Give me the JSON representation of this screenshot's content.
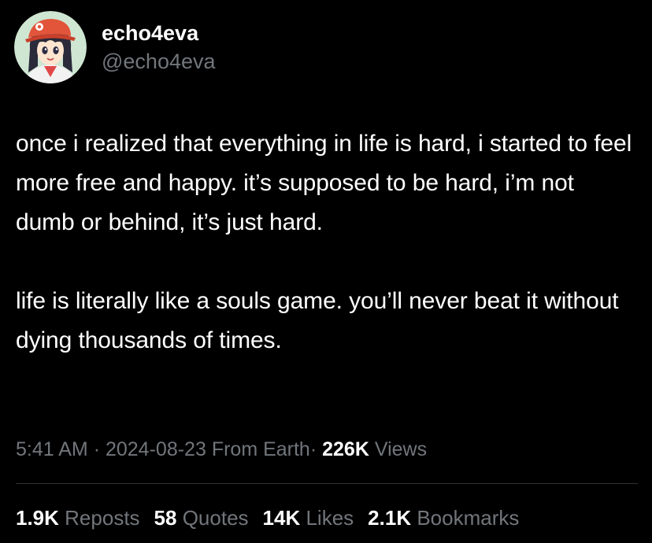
{
  "author": {
    "display_name": "echo4eva",
    "handle": "@echo4eva",
    "avatar_icon": "anime-girl-avatar"
  },
  "tweet": {
    "paragraphs": [
      "once i realized that everything in life is hard, i started to feel more free and happy. it’s supposed to be hard, i’m not dumb or behind, it’s just hard.",
      "life is literally like a souls game. you’ll never beat it without dying thousands of times."
    ]
  },
  "meta": {
    "time": "5:41 AM",
    "separator": "·",
    "date": "2024-08-23",
    "source": "From Earth",
    "views_count": "226K",
    "views_label": "Views"
  },
  "stats": {
    "reposts_count": "1.9K",
    "reposts_label": "Reposts",
    "quotes_count": "58",
    "quotes_label": "Quotes",
    "likes_count": "14K",
    "likes_label": "Likes",
    "bookmarks_count": "2.1K",
    "bookmarks_label": "Bookmarks"
  },
  "colors": {
    "background": "#000000",
    "primary_text": "#ffffff",
    "secondary_text": "#71767b",
    "divider": "#2f3336"
  }
}
